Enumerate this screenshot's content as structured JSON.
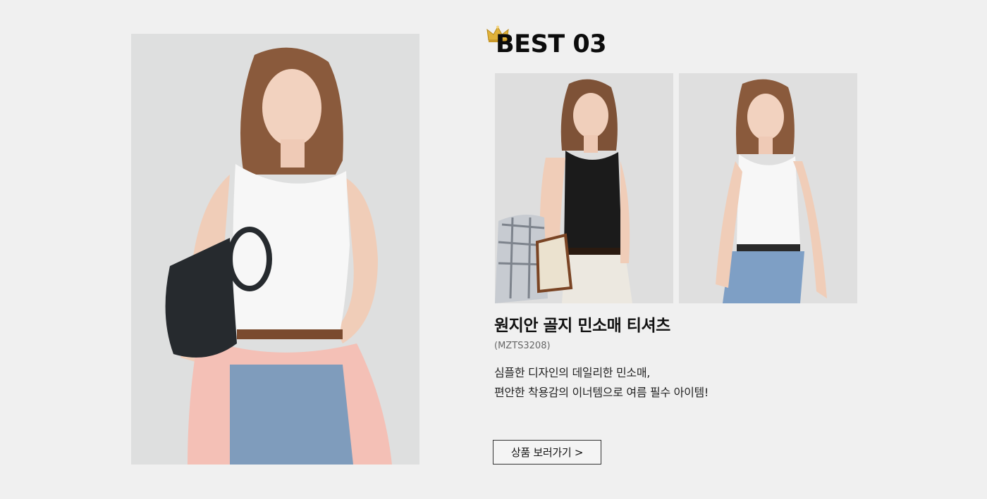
{
  "best": {
    "title": "BEST 03",
    "crown_icon": "crown-icon"
  },
  "product": {
    "name": "원지안 골지 민소매 티셔츠",
    "code": "(MZTS3208)",
    "description": [
      "심플한 디자인의  데일리한 민소매,",
      "편안한 착용감의 이너템으로 여름 필수 아이템!"
    ],
    "cta_label": "상품 보러가기 >"
  },
  "images": {
    "main": "model-white-tank-black-bag",
    "sub1": "model-black-tank-plaid-shirt",
    "sub2": "model-white-tank-denim"
  },
  "colors": {
    "background": "#f0f0f0",
    "text": "#111111",
    "crown": "#e0b23a"
  }
}
